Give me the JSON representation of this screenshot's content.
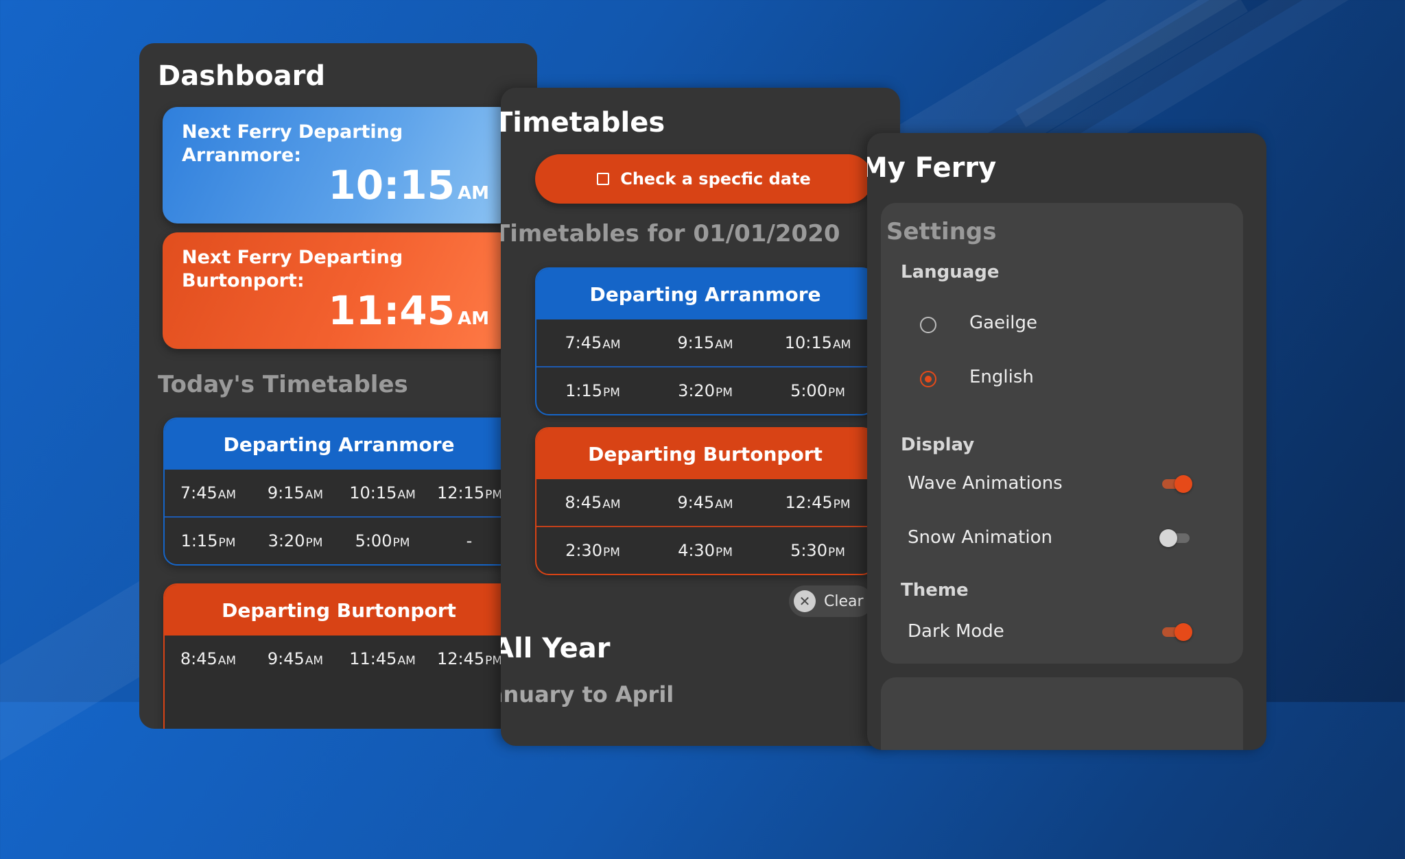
{
  "dashboard": {
    "title": "Dashboard",
    "next_arranmore": {
      "label": "Next Ferry Departing Arranmore:",
      "time": "10:15",
      "ampm": "AM"
    },
    "next_burtonport": {
      "label": "Next Ferry Departing Burtonport:",
      "time": "11:45",
      "ampm": "AM"
    },
    "today_heading": "Today's Timetables",
    "arranmore": {
      "title": "Departing Arranmore",
      "rows": [
        [
          {
            "t": "7:45",
            "p": "AM"
          },
          {
            "t": "9:15",
            "p": "AM"
          },
          {
            "t": "10:15",
            "p": "AM"
          },
          {
            "t": "12:15",
            "p": "PM"
          }
        ],
        [
          {
            "t": "1:15",
            "p": "PM"
          },
          {
            "t": "3:20",
            "p": "PM"
          },
          {
            "t": "5:00",
            "p": "PM"
          },
          {
            "t": "-",
            "p": ""
          }
        ]
      ]
    },
    "burtonport": {
      "title": "Departing Burtonport",
      "rows": [
        [
          {
            "t": "8:45",
            "p": "AM"
          },
          {
            "t": "9:45",
            "p": "AM"
          },
          {
            "t": "11:45",
            "p": "AM"
          },
          {
            "t": "12:45",
            "p": "PM"
          }
        ]
      ]
    }
  },
  "timetables": {
    "title": "Timetables",
    "check_button": "Check a specfic date",
    "date_heading": "Timetables for 01/01/2020",
    "arranmore": {
      "title": "Departing Arranmore",
      "rows": [
        [
          {
            "t": "7:45",
            "p": "AM"
          },
          {
            "t": "9:15",
            "p": "AM"
          },
          {
            "t": "10:15",
            "p": "AM"
          }
        ],
        [
          {
            "t": "1:15",
            "p": "PM"
          },
          {
            "t": "3:20",
            "p": "PM"
          },
          {
            "t": "5:00",
            "p": "PM"
          }
        ]
      ]
    },
    "burtonport": {
      "title": "Departing Burtonport",
      "rows": [
        [
          {
            "t": "8:45",
            "p": "AM"
          },
          {
            "t": "9:45",
            "p": "AM"
          },
          {
            "t": "12:45",
            "p": "PM"
          }
        ],
        [
          {
            "t": "2:30",
            "p": "PM"
          },
          {
            "t": "4:30",
            "p": "PM"
          },
          {
            "t": "5:30",
            "p": "PM"
          }
        ]
      ]
    },
    "clear_label": "Clear",
    "all_year_heading": "All Year",
    "range_heading": "January to April"
  },
  "my_ferry": {
    "title": "My Ferry",
    "settings_heading": "Settings",
    "language_label": "Language",
    "languages": [
      {
        "label": "Gaeilge",
        "selected": false
      },
      {
        "label": "English",
        "selected": true
      }
    ],
    "display_label": "Display",
    "wave_label": "Wave Animations",
    "wave_on": true,
    "snow_label": "Snow Animation",
    "snow_on": false,
    "theme_label": "Theme",
    "dark_label": "Dark Mode",
    "dark_on": true
  },
  "colors": {
    "blue": "#1565c8",
    "orange": "#d84315",
    "panel": "#353535",
    "accent": "#e64a19"
  }
}
